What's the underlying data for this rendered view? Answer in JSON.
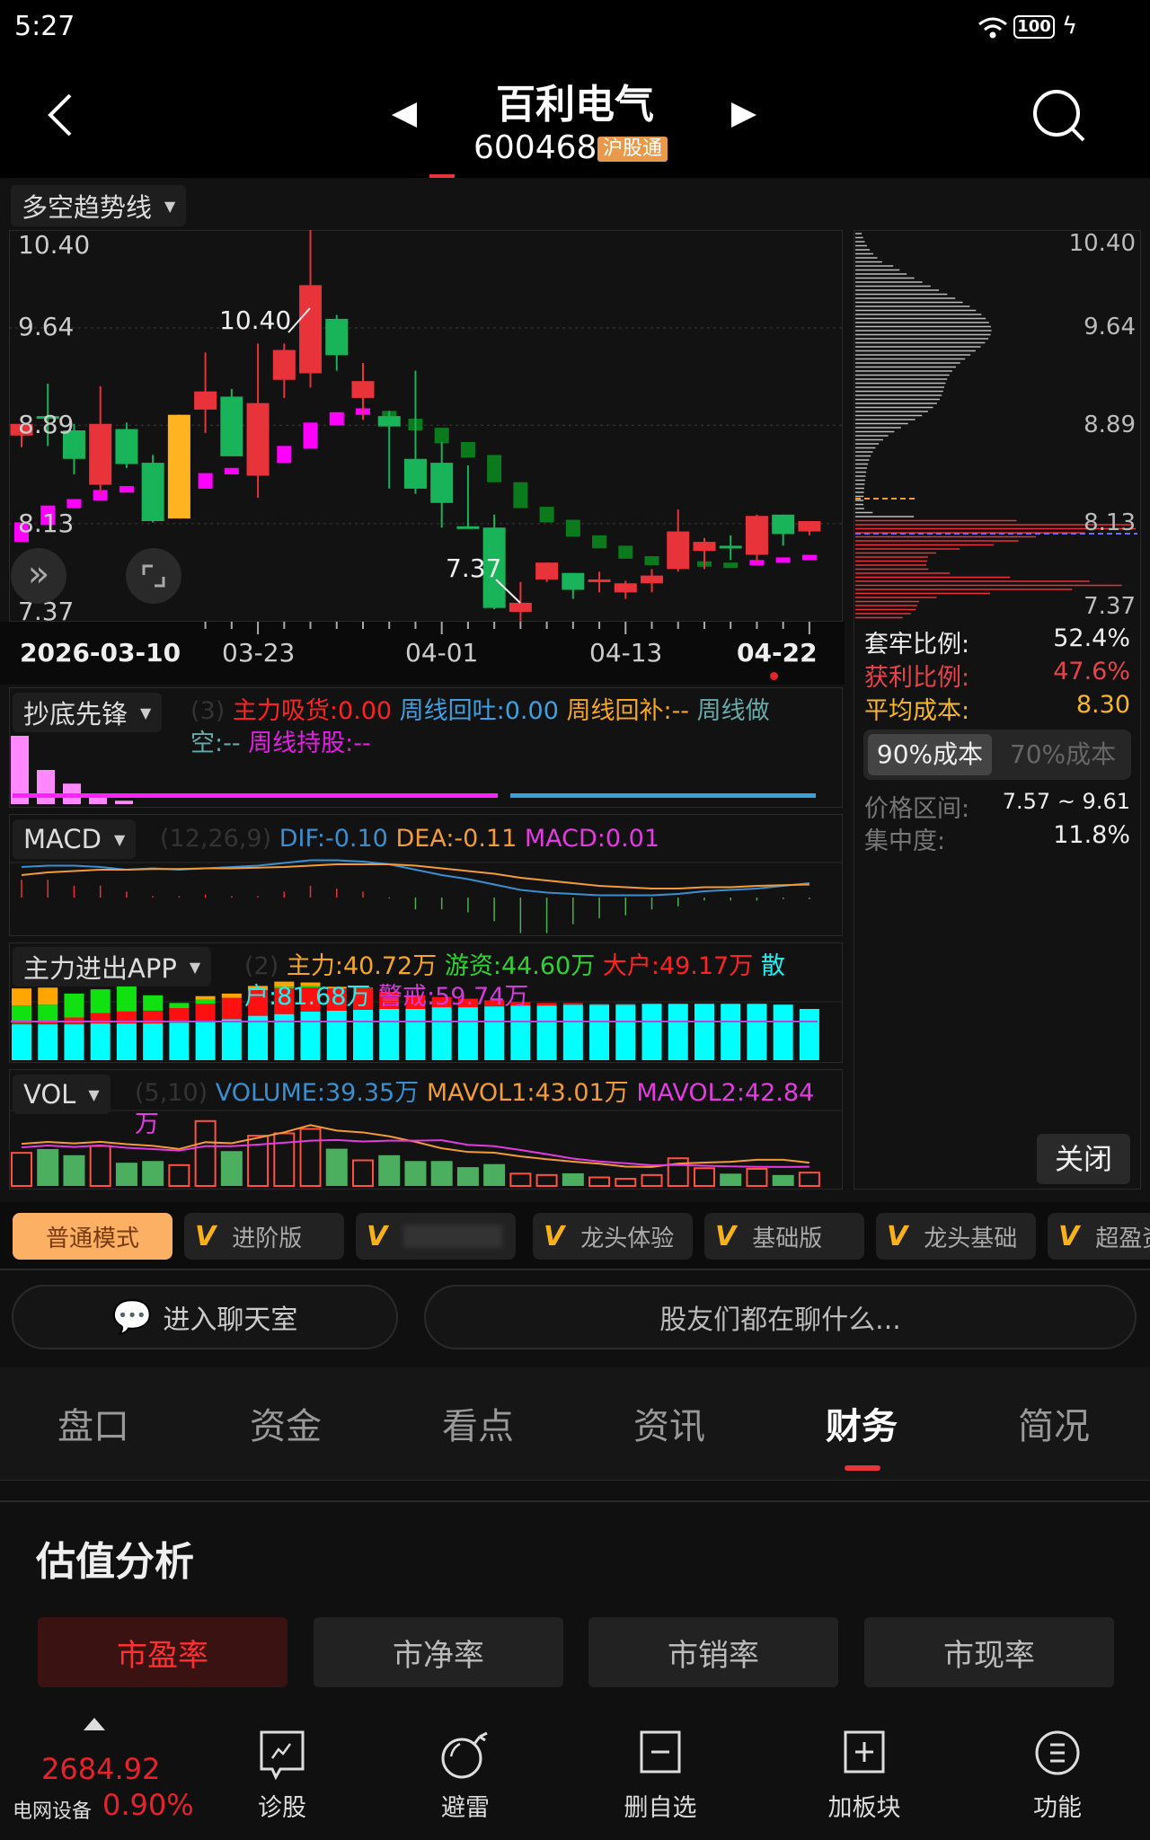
{
  "status_bar": {
    "time": "5:27",
    "battery": "100"
  },
  "header": {
    "title": "百利电气",
    "code": "600468",
    "badge": "沪股通"
  },
  "indicator": {
    "label": "多空趋势线"
  },
  "price_axis": [
    "10.40",
    "9.64",
    "8.89",
    "8.13",
    "7.37"
  ],
  "annotations": {
    "high": "10.40",
    "low": "7.37"
  },
  "dates": [
    "2026-03-10",
    "03-23",
    "04-01",
    "04-13",
    "04-22"
  ],
  "colors": {
    "up": "#e8333a",
    "down": "#19b35a",
    "trend_up": "#ff00ff",
    "trend_down": "#0b7a1c",
    "highlight": "#ffb320"
  },
  "chart_data": {
    "type": "candlestick",
    "price_range": [
      7.37,
      10.4
    ],
    "candles": [
      [
        8.81,
        8.9,
        8.72,
        8.9
      ],
      [
        8.96,
        9.21,
        8.73,
        8.95
      ],
      [
        8.85,
        8.9,
        8.51,
        8.63
      ],
      [
        8.43,
        9.19,
        8.35,
        8.9
      ],
      [
        8.86,
        8.91,
        8.56,
        8.59
      ],
      [
        8.6,
        8.66,
        8.14,
        8.15
      ],
      [
        8.17,
        8.97,
        8.17,
        8.97,
        "hl"
      ],
      [
        9.01,
        9.45,
        8.83,
        9.15
      ],
      [
        9.11,
        9.17,
        8.65,
        8.65
      ],
      [
        8.5,
        9.52,
        8.33,
        9.06
      ],
      [
        9.24,
        9.52,
        9.1,
        9.47
      ],
      [
        9.29,
        10.4,
        9.18,
        9.97
      ],
      [
        9.71,
        9.74,
        9.31,
        9.43
      ],
      [
        9.1,
        9.37,
        8.93,
        9.23
      ],
      [
        8.96,
        9.0,
        8.4,
        8.88
      ],
      [
        8.63,
        9.31,
        8.36,
        8.4
      ],
      [
        8.6,
        8.76,
        8.1,
        8.29
      ],
      [
        8.11,
        8.58,
        8.1,
        8.1
      ],
      [
        8.1,
        8.2,
        7.47,
        7.48
      ],
      [
        7.45,
        7.68,
        7.37,
        7.52
      ],
      [
        7.7,
        7.83,
        7.68,
        7.83
      ],
      [
        7.75,
        7.75,
        7.55,
        7.62
      ],
      [
        7.69,
        7.76,
        7.6,
        7.7
      ],
      [
        7.6,
        7.69,
        7.55,
        7.67
      ],
      [
        7.67,
        7.78,
        7.6,
        7.73
      ],
      [
        7.78,
        8.24,
        7.76,
        8.07
      ],
      [
        7.92,
        8.02,
        7.78,
        7.99
      ],
      [
        7.96,
        8.04,
        7.85,
        7.95
      ],
      [
        7.89,
        8.2,
        7.83,
        8.19
      ],
      [
        8.2,
        8.2,
        7.96,
        8.05
      ],
      [
        8.07,
        8.15,
        8.04,
        8.15
      ]
    ],
    "trend": [
      [
        8.14,
        7.99,
        "up"
      ],
      [
        8.27,
        8.12,
        "up"
      ],
      [
        8.32,
        8.25,
        "up"
      ],
      [
        8.39,
        8.31,
        "up"
      ],
      [
        8.42,
        8.37,
        "up"
      ],
      [
        8.42,
        8.37,
        "down"
      ],
      [
        8.42,
        8.37,
        "up"
      ],
      [
        8.52,
        8.4,
        "up"
      ],
      [
        8.56,
        8.51,
        "up"
      ],
      [
        8.61,
        8.54,
        "up"
      ],
      [
        8.73,
        8.6,
        "up"
      ],
      [
        8.91,
        8.71,
        "up"
      ],
      [
        8.99,
        8.89,
        "up"
      ],
      [
        9.02,
        8.97,
        "up"
      ],
      [
        9.0,
        8.92,
        "down"
      ],
      [
        8.94,
        8.85,
        "down"
      ],
      [
        8.87,
        8.75,
        "down"
      ],
      [
        8.76,
        8.64,
        "down"
      ],
      [
        8.66,
        8.45,
        "down"
      ],
      [
        8.45,
        8.25,
        "down"
      ],
      [
        8.26,
        8.14,
        "down"
      ],
      [
        8.16,
        8.03,
        "down"
      ],
      [
        8.04,
        7.94,
        "down"
      ],
      [
        7.96,
        7.86,
        "down"
      ],
      [
        7.88,
        7.81,
        "down"
      ],
      [
        7.84,
        7.81,
        "up"
      ],
      [
        7.84,
        7.82,
        "down"
      ],
      [
        7.83,
        7.81,
        "down"
      ],
      [
        7.85,
        7.82,
        "up"
      ],
      [
        7.87,
        7.84,
        "up"
      ],
      [
        7.89,
        7.85,
        "up"
      ]
    ],
    "macd": {
      "hist": [
        0.06,
        0.06,
        0.04,
        0.04,
        0.02,
        0.005,
        0.005,
        0.01,
        0.005,
        0.005,
        0.02,
        0.04,
        0.03,
        0.02,
        -0.003,
        -0.04,
        -0.04,
        -0.05,
        -0.08,
        -0.12,
        -0.12,
        -0.09,
        -0.07,
        -0.06,
        -0.04,
        -0.03,
        -0.01,
        -0.01,
        -0.01,
        -0.005,
        -0.005
      ],
      "dif": [
        0.02,
        0.03,
        0.03,
        0.02,
        0.0,
        0.01,
        0.0,
        0.01,
        0.02,
        0.03,
        0.05,
        0.07,
        0.07,
        0.06,
        0.04,
        0.0,
        -0.04,
        -0.07,
        -0.11,
        -0.15,
        -0.17,
        -0.18,
        -0.19,
        -0.19,
        -0.19,
        -0.18,
        -0.16,
        -0.15,
        -0.14,
        -0.12,
        -0.1
      ],
      "dea": [
        -0.04,
        -0.02,
        -0.01,
        0.0,
        0.0,
        0.005,
        0.005,
        0.01,
        0.01,
        0.015,
        0.02,
        0.03,
        0.04,
        0.04,
        0.04,
        0.03,
        0.01,
        -0.01,
        -0.03,
        -0.06,
        -0.08,
        -0.1,
        -0.12,
        -0.13,
        -0.14,
        -0.14,
        -0.13,
        -0.13,
        -0.12,
        -0.115,
        -0.11
      ]
    },
    "flow": {
      "retail": [
        0.42,
        0.42,
        0.42,
        0.43,
        0.43,
        0.43,
        0.44,
        0.46,
        0.48,
        0.52,
        0.54,
        0.57,
        0.58,
        0.59,
        0.6,
        0.6,
        0.62,
        0.62,
        0.63,
        0.64,
        0.64,
        0.65,
        0.65,
        0.65,
        0.66,
        0.66,
        0.66,
        0.66,
        0.66,
        0.65,
        0.6
      ],
      "big": [
        0.02,
        0.03,
        0.08,
        0.12,
        0.14,
        0.15,
        0.17,
        0.2,
        0.25,
        0.3,
        0.3,
        0.28,
        0.26,
        0.25,
        0.2,
        0.16,
        0.12,
        0.1,
        0.07,
        0.04,
        0.03,
        0.02,
        0.01,
        0.01,
        0,
        0,
        0,
        0,
        0,
        0,
        0
      ],
      "hot": [
        0.2,
        0.2,
        0.28,
        0.28,
        0.3,
        0.18,
        0.06,
        0.05,
        0,
        0,
        0.02,
        0.02,
        0,
        0.01,
        0,
        0,
        0,
        0,
        0,
        0,
        0,
        0,
        0,
        0,
        0,
        0,
        0,
        0,
        0,
        0,
        0
      ],
      "main": [
        0.2,
        0.2,
        0,
        0,
        0,
        0,
        0,
        0.04,
        0.05,
        0.05,
        0.06,
        0.04,
        0.02,
        0,
        0,
        0,
        0,
        0,
        0,
        0,
        0,
        0,
        0,
        0,
        0,
        0,
        0,
        0,
        0,
        0,
        0
      ]
    },
    "volume": [
      97,
      108,
      90,
      117,
      68,
      73,
      61,
      190,
      102,
      147,
      154,
      167,
      109,
      75,
      90,
      73,
      73,
      55,
      64,
      36,
      32,
      37,
      25,
      21,
      32,
      81,
      52,
      36,
      50,
      32,
      39
    ],
    "bottom_signal": [
      1,
      0.5,
      0.3,
      0.15,
      0.05
    ]
  },
  "panels": {
    "bottom": {
      "label": "抄底先锋",
      "param": "(3)",
      "items": [
        "主力吸货:0.00",
        "周线回吐:0.00",
        "周线回补:--",
        "周线做",
        "空:--",
        "周线持股:--"
      ]
    },
    "macd": {
      "label": "MACD",
      "param": "(12,26,9)",
      "dif": "DIF:-0.10",
      "dea": "DEA:-0.11",
      "macd": "MACD:0.01"
    },
    "flow": {
      "label": "主力进出APP",
      "param": "(2)",
      "main": "主力:40.72万",
      "hot": "游资:44.60万",
      "big": "大户:49.17万",
      "retail_a": "散",
      "retail_b": "户:81.68万",
      "warn": "警戒:59.74万"
    },
    "vol": {
      "label": "VOL",
      "param": "(5,10)",
      "volume": "VOLUME:39.35万",
      "ma1": "MAVOL1:43.01万",
      "ma2": "MAVOL2:42.84",
      "ma2_unit": "万"
    }
  },
  "chips": {
    "price_axis": [
      "10.40",
      "9.64",
      "8.89",
      "8.13",
      "7.37"
    ],
    "trapped_label": "套牢比例:",
    "trapped": "52.4%",
    "profit_label": "获利比例:",
    "profit": "47.6%",
    "avg_label": "平均成本:",
    "avg": "8.30",
    "tab90": "90%成本",
    "tab70": "70%成本",
    "range_label": "价格区间:",
    "range": "7.57 ~ 9.61",
    "conc_label": "集中度:",
    "conc": "11.8%",
    "close": "关闭"
  },
  "modes": [
    "普通模式",
    "进阶版",
    "",
    "龙头体验",
    "基础版",
    "龙头基础",
    "超盈资"
  ],
  "chat": {
    "enter": "进入聊天室",
    "prompt": "股友们都在聊什么..."
  },
  "tabs": [
    "盘口",
    "资金",
    "看点",
    "资讯",
    "财务",
    "简况"
  ],
  "active_tab": 4,
  "valuation": {
    "title": "估值分析",
    "buttons": [
      "市盈率",
      "市净率",
      "市销率",
      "市现率"
    ]
  },
  "bottom_bar": {
    "index_value": "2684.92",
    "index_name": "电网设备",
    "index_change": "0.90%",
    "items": [
      "诊股",
      "避雷",
      "删自选",
      "加板块",
      "功能"
    ]
  }
}
